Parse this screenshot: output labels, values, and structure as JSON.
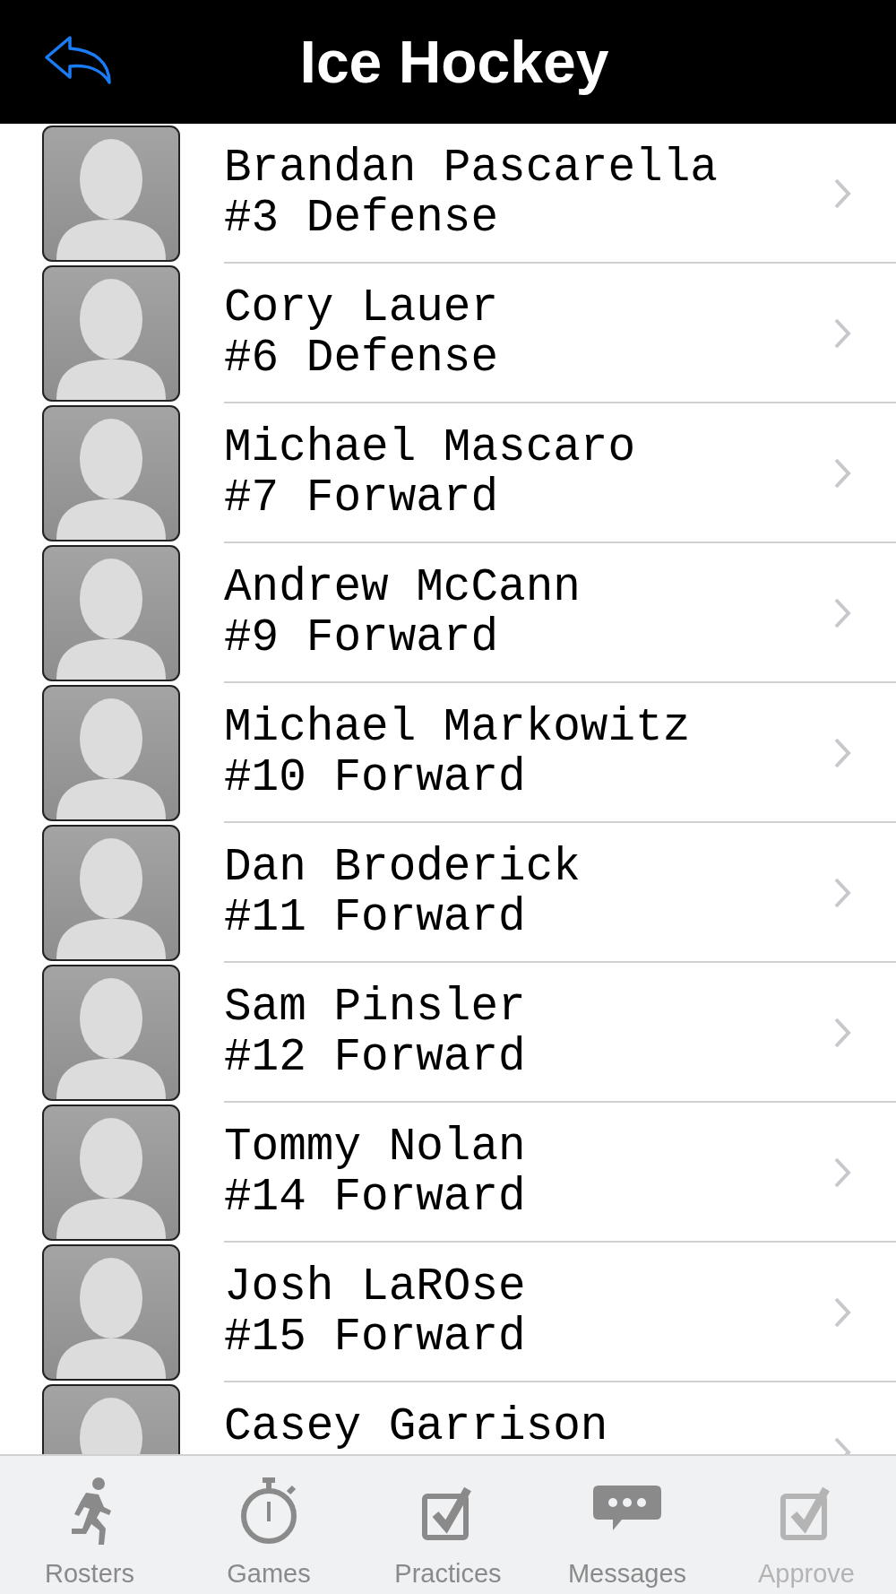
{
  "header": {
    "title": "Ice Hockey"
  },
  "players": [
    {
      "name": "Brandan Pascarella",
      "detail": "#3 Defense"
    },
    {
      "name": "Cory Lauer",
      "detail": "#6 Defense"
    },
    {
      "name": "Michael Mascaro",
      "detail": "#7 Forward"
    },
    {
      "name": "Andrew McCann",
      "detail": "#9 Forward"
    },
    {
      "name": "Michael Markowitz",
      "detail": "#10 Forward"
    },
    {
      "name": "Dan Broderick",
      "detail": "#11 Forward"
    },
    {
      "name": "Sam Pinsler",
      "detail": "#12 Forward"
    },
    {
      "name": "Tommy Nolan",
      "detail": "#14 Forward"
    },
    {
      "name": "Josh LaROse",
      "detail": "#15 Forward"
    },
    {
      "name": "Casey Garrison"
    }
  ],
  "tabs": [
    {
      "label": "Rosters",
      "kind": "runner",
      "disabled": false
    },
    {
      "label": "Games",
      "kind": "stopwatch",
      "disabled": false
    },
    {
      "label": "Practices",
      "kind": "checkbox",
      "disabled": false
    },
    {
      "label": "Messages",
      "kind": "chat",
      "disabled": false
    },
    {
      "label": "Approve",
      "kind": "checkbox",
      "disabled": true
    }
  ]
}
